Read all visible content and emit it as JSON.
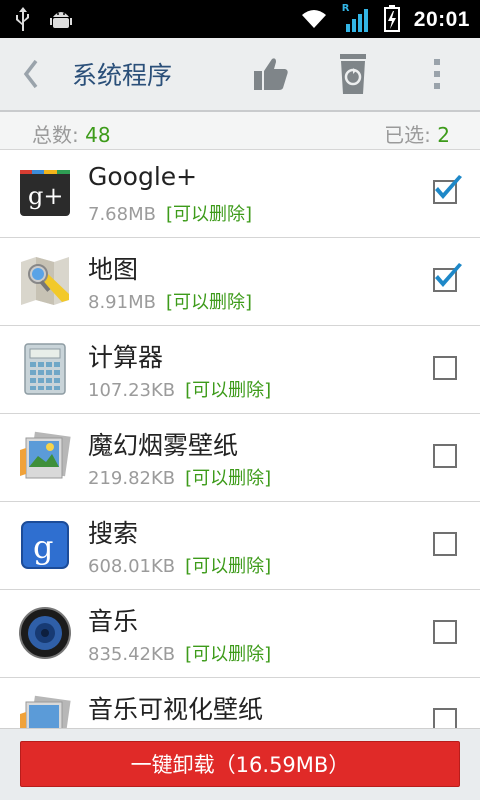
{
  "status_bar": {
    "time": "20:01",
    "icons": [
      "usb-icon",
      "android-debug-icon",
      "wifi-icon",
      "signal-icon",
      "battery-charging-icon"
    ],
    "signal_label": "R"
  },
  "action_bar": {
    "title": "系统程序",
    "icons": [
      "back-chevron-icon",
      "thumb-up-icon",
      "recycle-bin-icon",
      "overflow-menu-icon"
    ]
  },
  "summary": {
    "total_label": "总数:",
    "total_value": "48",
    "selected_label": "已选:",
    "selected_value": "2"
  },
  "apps": [
    {
      "name": "Google+",
      "size": "7.68MB",
      "tag": "[可以删除]",
      "checked": true,
      "icon": "google-plus-icon"
    },
    {
      "name": "地图",
      "size": "8.91MB",
      "tag": "[可以删除]",
      "checked": true,
      "icon": "maps-icon"
    },
    {
      "name": "计算器",
      "size": "107.23KB",
      "tag": "[可以删除]",
      "checked": false,
      "icon": "calculator-icon"
    },
    {
      "name": "魔幻烟雾壁纸",
      "size": "219.82KB",
      "tag": "[可以删除]",
      "checked": false,
      "icon": "wallpaper-icon"
    },
    {
      "name": "搜索",
      "size": "608.01KB",
      "tag": "[可以删除]",
      "checked": false,
      "icon": "google-search-icon"
    },
    {
      "name": "音乐",
      "size": "835.42KB",
      "tag": "[可以删除]",
      "checked": false,
      "icon": "music-speaker-icon"
    },
    {
      "name": "音乐可视化壁纸",
      "size": "",
      "tag": "",
      "checked": false,
      "icon": "wallpaper-icon"
    }
  ],
  "bottom": {
    "button_label": "一键卸载（16.59MB）"
  },
  "colors": {
    "title": "#2a4f79",
    "accent_green": "#3d9b1a",
    "check_blue": "#1e88c8",
    "button_red": "#e02a28"
  }
}
